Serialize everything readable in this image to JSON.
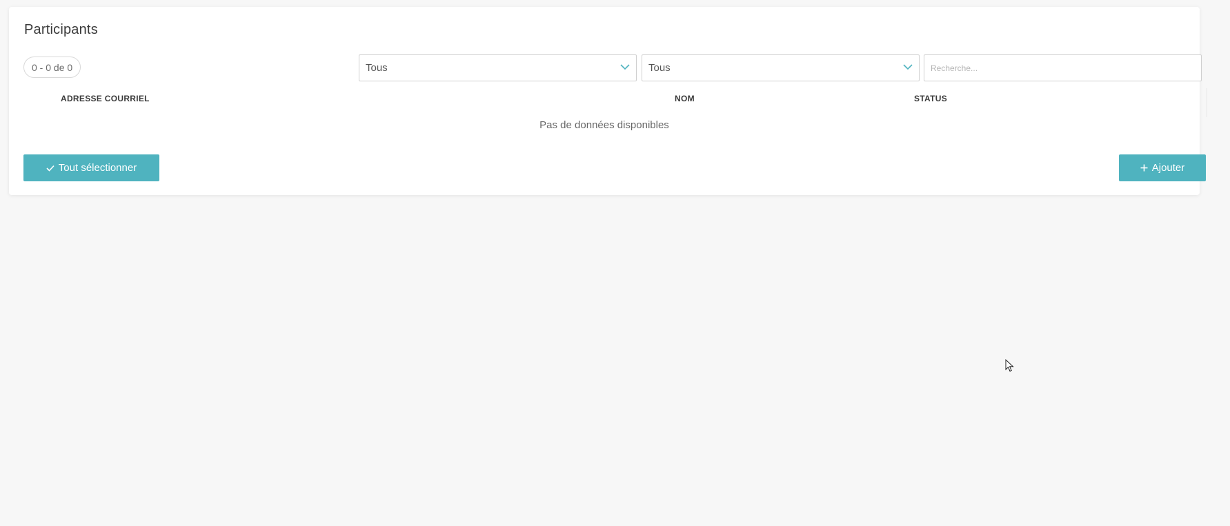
{
  "panel": {
    "title": "Participants",
    "counter": "0 - 0 de 0"
  },
  "filters": {
    "filter1_value": "Tous",
    "filter2_value": "Tous",
    "search_placeholder": "Recherche..."
  },
  "table": {
    "columns": [
      "ADRESSE COURRIEL",
      "NOM",
      "STATUS"
    ],
    "empty_message": "Pas de données disponibles",
    "rows": []
  },
  "actions": {
    "select_all_label": "Tout sélectionner",
    "select_all_icon": "check-icon",
    "add_label": "Ajouter",
    "add_icon": "plus-icon"
  },
  "colors": {
    "accent": "#4fb3bf",
    "background": "#f7f7f7"
  }
}
